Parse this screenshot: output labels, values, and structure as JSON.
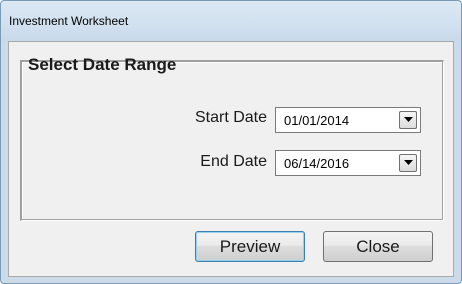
{
  "window": {
    "title": "Investment Worksheet"
  },
  "group": {
    "title": "Select Date Range"
  },
  "fields": {
    "start_date": {
      "label": "Start Date",
      "value": "01/01/2014"
    },
    "end_date": {
      "label": "End Date",
      "value": "06/14/2016"
    }
  },
  "buttons": {
    "preview_label": "Preview",
    "close_label": "Close"
  },
  "icons": {
    "dropdown": "chevron-down-icon"
  },
  "colors": {
    "title_bar": "#d3e2f0",
    "client_background": "#f0f0f0",
    "default_button_border": "#3c7fb1"
  }
}
